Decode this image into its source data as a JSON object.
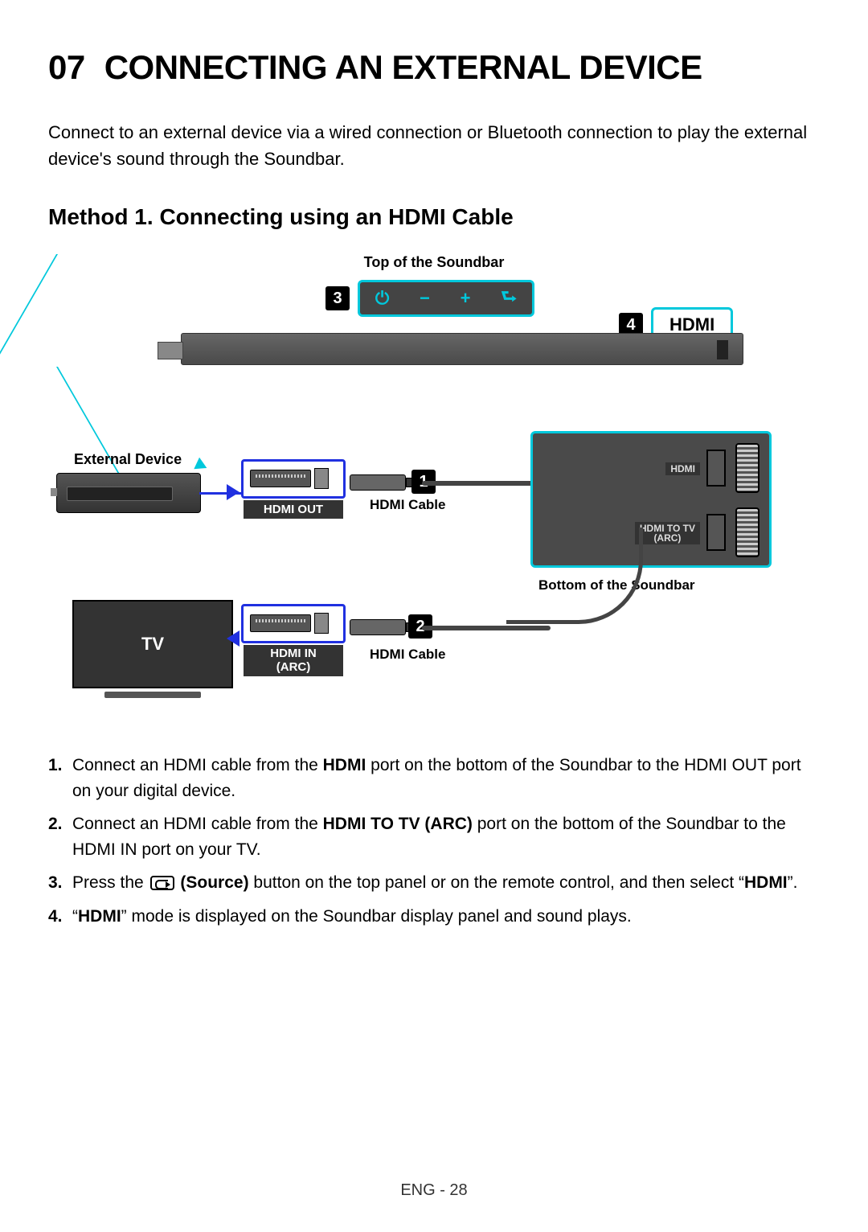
{
  "chapter": {
    "num": "07",
    "title": "CONNECTING AN EXTERNAL DEVICE"
  },
  "intro": "Connect to an external device via a wired connection or Bluetooth connection to play the external device's sound through the Soundbar.",
  "method_title": "Method 1. Connecting using an HDMI Cable",
  "diagram": {
    "top_soundbar": "Top of the Soundbar",
    "callout3": "3",
    "callout4": "4",
    "hdmi_big": "HDMI",
    "external_device": "External Device",
    "hdmi_out": "HDMI OUT",
    "hdmi_cable": "HDMI Cable",
    "callout1": "1",
    "callout2": "2",
    "rear_hdmi": "HDMI",
    "rear_hdmi_arc": "HDMI TO TV\n(ARC)",
    "bottom_soundbar": "Bottom of the Soundbar",
    "tv": "TV",
    "hdmi_in": "HDMI IN",
    "arc": "(ARC)"
  },
  "steps": [
    {
      "n": "1.",
      "pre": "Connect an HDMI cable from the ",
      "b1": "HDMI",
      "post": " port on the bottom of the Soundbar to the HDMI OUT port on your digital device."
    },
    {
      "n": "2.",
      "pre": "Connect an HDMI cable from the ",
      "b1": "HDMI TO TV (ARC)",
      "post": " port on the bottom of the Soundbar to the HDMI IN port on your TV."
    },
    {
      "n": "3.",
      "pre": "Press the ",
      "b1": "(Source)",
      "mid": " button on the top panel or on the remote control, and then select “",
      "b2": "HDMI",
      "post2": "”."
    },
    {
      "n": "4.",
      "pre": "“",
      "b1": "HDMI",
      "post": "” mode is displayed on the Soundbar display panel and sound plays."
    }
  ],
  "footer": "ENG - 28"
}
